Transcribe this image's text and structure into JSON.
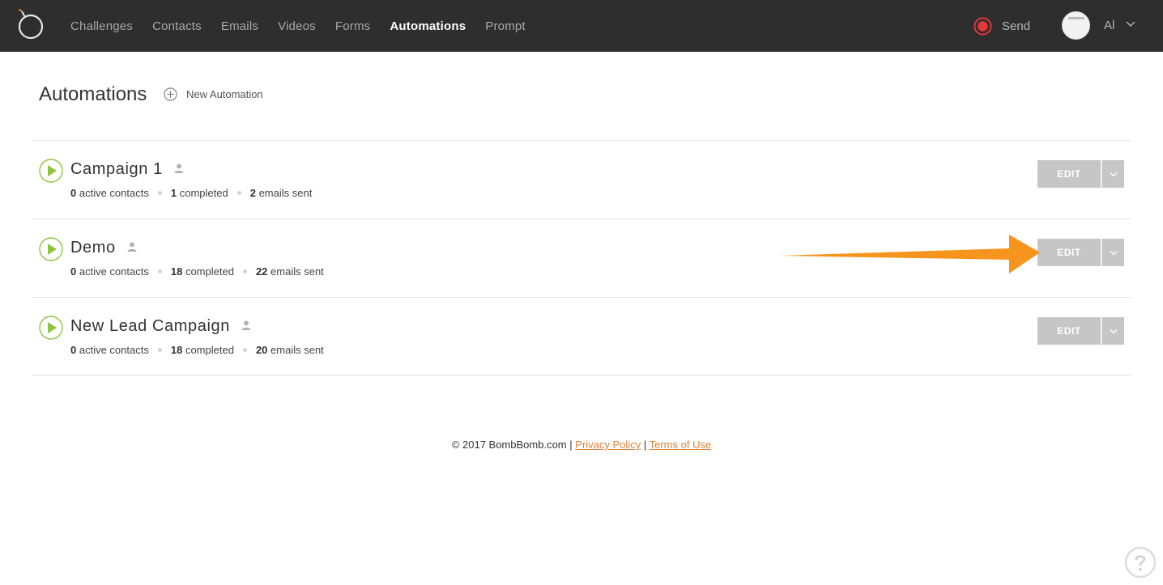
{
  "nav": {
    "items": [
      {
        "label": "Challenges",
        "active": false
      },
      {
        "label": "Contacts",
        "active": false
      },
      {
        "label": "Emails",
        "active": false
      },
      {
        "label": "Videos",
        "active": false
      },
      {
        "label": "Forms",
        "active": false
      },
      {
        "label": "Automations",
        "active": true
      },
      {
        "label": "Prompt",
        "active": false
      }
    ],
    "send_label": "Send",
    "user_initials": "Al"
  },
  "page": {
    "title": "Automations",
    "new_automation_label": "New Automation"
  },
  "automations": [
    {
      "name": "Campaign 1",
      "active_count": "0",
      "active_label": "active contacts",
      "completed_count": "1",
      "completed_label": "completed",
      "sent_count": "2",
      "sent_label": "emails sent",
      "edit_label": "EDIT"
    },
    {
      "name": "Demo",
      "active_count": "0",
      "active_label": "active contacts",
      "completed_count": "18",
      "completed_label": "completed",
      "sent_count": "22",
      "sent_label": "emails sent",
      "edit_label": "EDIT"
    },
    {
      "name": "New Lead Campaign",
      "active_count": "0",
      "active_label": "active contacts",
      "completed_count": "18",
      "completed_label": "completed",
      "sent_count": "20",
      "sent_label": "emails sent",
      "edit_label": "EDIT"
    }
  ],
  "footer": {
    "copyright": "© 2017 BombBomb.com",
    "separator": "|",
    "privacy": "Privacy Policy",
    "terms": "Terms of Use"
  },
  "colors": {
    "topbar": "#2e2e2e",
    "accent_orange": "#f7941d",
    "play_green": "#8cc63f",
    "record_red": "#e53935",
    "button_gray": "#c6c6c6",
    "link_orange": "#e0813a"
  },
  "icons": [
    "bombbomb-logo-icon",
    "record-icon",
    "avatar",
    "chevron-down-icon",
    "plus-circle-icon",
    "play-icon",
    "person-icon",
    "caret-down-icon",
    "arrow-annotation",
    "help-icon"
  ]
}
